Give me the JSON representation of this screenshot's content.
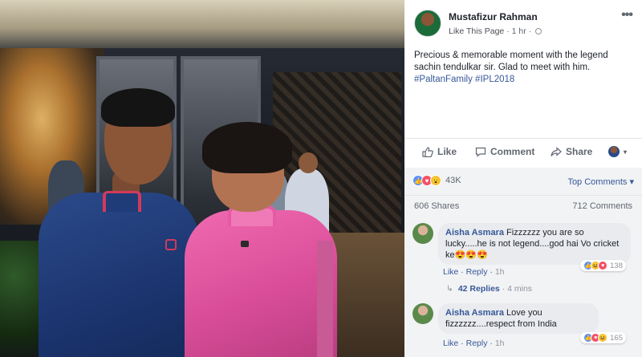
{
  "post": {
    "author": "Mustafizur Rahman",
    "like_page": "Like This Page",
    "separator": "·",
    "time": "1 hr",
    "separator2": "·",
    "more": "•••",
    "text_line1": "Precious & memorable moment with the legend",
    "text_line2": "sachin tendulkar sir. Glad to meet with him.",
    "hashtags": "#PaltanFamily #IPL2018"
  },
  "actions": {
    "like": "Like",
    "comment": "Comment",
    "share": "Share",
    "caret": "▾"
  },
  "stats": {
    "reactions_count": "43K",
    "top_comments": "Top Comments ▾",
    "shares": "606 Shares",
    "comments": "712 Comments"
  },
  "comments": [
    {
      "author": "Aisha Asmara",
      "text": "Fizzzzzz you are so lucky.....he is not legend....god hai Vo cricket ke😍😍😍",
      "like": "Like",
      "reply": "Reply",
      "time": "1h",
      "reaction_count": "138"
    },
    {
      "author": "Aisha Asmara",
      "text": "Love you fizzzzzz....respect from India",
      "like": "Like",
      "reply": "Reply",
      "time": "1h",
      "reaction_count": "165"
    }
  ],
  "replies": {
    "label": "42 Replies",
    "time": "4 mins",
    "separator": "·"
  },
  "colors": {
    "link": "#365899",
    "like_blue": "#5890ff",
    "love_red": "#f25268",
    "wow_yellow": "#f7c23a"
  }
}
